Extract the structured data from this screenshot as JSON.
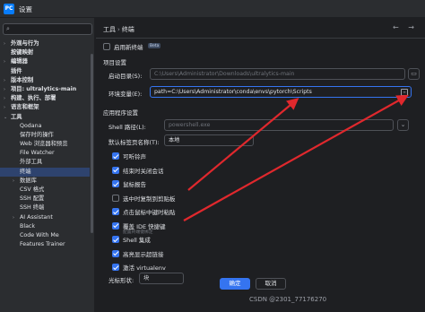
{
  "window": {
    "title": "设置",
    "app_icon": "PC"
  },
  "sidebar": {
    "search_placeholder": "",
    "items": [
      {
        "label": "外观与行为",
        "arrow": "›",
        "indent": 0,
        "bold": true
      },
      {
        "label": "按键映射",
        "arrow": "",
        "indent": 0,
        "bold": true
      },
      {
        "label": "编辑器",
        "arrow": "›",
        "indent": 0,
        "bold": true
      },
      {
        "label": "插件",
        "arrow": "",
        "indent": 0,
        "bold": true
      },
      {
        "label": "版本控制",
        "arrow": "›",
        "indent": 0,
        "bold": true
      },
      {
        "label": "项目: ultralytics-main",
        "arrow": "›",
        "indent": 0,
        "bold": true
      },
      {
        "label": "构建、执行、部署",
        "arrow": "›",
        "indent": 0,
        "bold": true
      },
      {
        "label": "语言和框架",
        "arrow": "›",
        "indent": 0,
        "bold": true
      },
      {
        "label": "工具",
        "arrow": "⌄",
        "indent": 0,
        "bold": true
      },
      {
        "label": "Qodana",
        "arrow": "",
        "indent": 1,
        "bold": false
      },
      {
        "label": "保存时的操作",
        "arrow": "",
        "indent": 1,
        "bold": false
      },
      {
        "label": "Web 浏览器和预览",
        "arrow": "",
        "indent": 1,
        "bold": false
      },
      {
        "label": "File Watcher",
        "arrow": "",
        "indent": 1,
        "bold": false
      },
      {
        "label": "外部工具",
        "arrow": "",
        "indent": 1,
        "bold": false
      },
      {
        "label": "终端",
        "arrow": "",
        "indent": 1,
        "bold": false,
        "selected": true
      },
      {
        "label": "数据库",
        "arrow": "›",
        "indent": 1,
        "bold": false
      },
      {
        "label": "CSV 格式",
        "arrow": "",
        "indent": 1,
        "bold": false
      },
      {
        "label": "SSH 配置",
        "arrow": "",
        "indent": 1,
        "bold": false
      },
      {
        "label": "SSH 终端",
        "arrow": "",
        "indent": 1,
        "bold": false
      },
      {
        "label": "AI Assistant",
        "arrow": "›",
        "indent": 1,
        "bold": false
      },
      {
        "label": "Black",
        "arrow": "",
        "indent": 1,
        "bold": false
      },
      {
        "label": "Code With Me",
        "arrow": "",
        "indent": 1,
        "bold": false
      },
      {
        "label": "Features Trainer",
        "arrow": "",
        "indent": 1,
        "bold": false
      }
    ]
  },
  "main": {
    "breadcrumb": {
      "parent": "工具",
      "separator": "›",
      "current": "终端"
    },
    "nav": "← →",
    "new_terminal": {
      "label": "启用新终端",
      "badge": "Beta",
      "checked": false
    },
    "project_settings": {
      "section": "项目设置",
      "start_dir_label": "启动目录(S):",
      "start_dir_value": "C:\\Users\\Administrator\\Downloads\\ultralytics-main",
      "env_label": "环境变量(E):",
      "env_value": "path=C:\\Users\\Administrator\\conda\\envs\\pytorch\\Scripts"
    },
    "app_settings": {
      "section": "应用程序设置",
      "shell_label": "Shell 路径(L):",
      "shell_value": "powershell.exe",
      "tab_name_label": "默认标签页名称(T):",
      "tab_name_value": "本地",
      "options": [
        {
          "label": "可听铃声",
          "checked": true
        },
        {
          "label": "结束时关闭会话",
          "checked": true
        },
        {
          "label": "鼠标报告",
          "checked": true
        },
        {
          "label": "选中时复制到剪贴板",
          "checked": false
        },
        {
          "label": "点击鼠标中键时粘贴",
          "checked": true
        },
        {
          "label": "覆盖 IDE 快捷键",
          "checked": true,
          "link": "配置终端键绑定"
        },
        {
          "label": "Shell 集成",
          "checked": true
        },
        {
          "label": "高亮显示超链接",
          "checked": true
        },
        {
          "label": "激活 virtualenv",
          "checked": true
        }
      ],
      "cursor_label": "光标形状:",
      "cursor_value": "块"
    }
  },
  "footer": {
    "ok": "确定",
    "cancel": "取消"
  },
  "watermark": "CSDN @2301_77176270",
  "colors": {
    "accent": "#3574f0",
    "arrow": "#e0282d",
    "selection": "#2e436e"
  }
}
